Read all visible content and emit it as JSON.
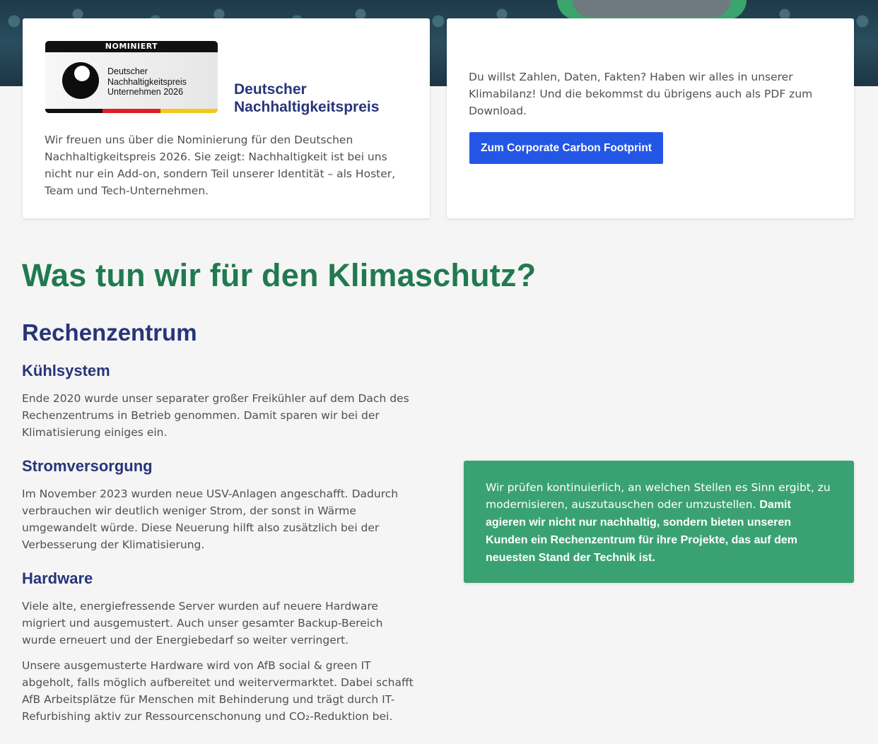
{
  "badge": {
    "top_label": "NOMINIERT",
    "line1": "Deutscher",
    "line2": "Nachhaltigkeitspreis",
    "line3": "Unternehmen 2026"
  },
  "prize": {
    "title_line1": "Deutscher",
    "title_line2": "Nachhaltigkeitspreis",
    "text": "Wir freuen uns über die Nominierung für den Deutschen Nachhaltigkeitspreis 2026. Sie zeigt: Nachhaltigkeit ist bei uns nicht nur ein Add-on, sondern Teil unserer Identität – als Hoster, Team und Tech-Unternehmen."
  },
  "carbon": {
    "text": "Du willst Zahlen, Daten, Fakten? Haben wir alles in unserer Klimabilanz! Und die bekommst du übrigens auch als PDF zum Download.",
    "button_label": "Zum Corporate Carbon Footprint"
  },
  "main": {
    "heading": "Was tun wir für den Klimaschutz?",
    "section_title": "Rechenzentrum",
    "cooling": {
      "title": "Kühlsystem",
      "text": "Ende 2020 wurde unser separater großer Freikühler auf dem Dach des Rechenzentrums in Betrieb genommen. Damit sparen wir bei der Klimatisierung einiges ein."
    },
    "power": {
      "title": "Stromversorgung",
      "text": "Im November 2023 wurden neue USV-Anlagen angeschafft. Dadurch verbrauchen wir deutlich weniger Strom, der sonst in Wärme umgewandelt würde. Diese Neuerung hilft also zusätzlich bei der Verbesserung der Klimatisierung."
    },
    "hardware": {
      "title": "Hardware",
      "text1": "Viele alte, energiefressende Server wurden auf neuere Hardware migriert und ausgemustert. Auch unser gesamter Backup-Bereich wurde erneuert und der Energiebedarf so weiter verringert.",
      "text2": "Unsere ausgemusterte Hardware wird von AfB social & green IT abgeholt, falls möglich aufbereitet und weitervermarktet. Dabei schafft AfB Arbeitsplätze für Menschen mit Behinderung und trägt durch IT-Refurbishing aktiv zur Ressourcenschonung und CO₂-Reduktion bei."
    },
    "callout": {
      "normal": "Wir prüfen kontinuierlich, an welchen Stellen es Sinn ergibt, zu modernisieren, auszutauschen oder umzustellen. ",
      "bold": "Damit agieren wir nicht nur nachhaltig, sondern bieten unseren Kunden ein Rechenzentrum für ihre Projekte, das auf dem neuesten Stand der Technik ist."
    }
  },
  "colors": {
    "heading_green": "#217a4f",
    "heading_blue": "#27357a",
    "button_blue": "#2456e6",
    "callout_green": "#3aa272"
  }
}
